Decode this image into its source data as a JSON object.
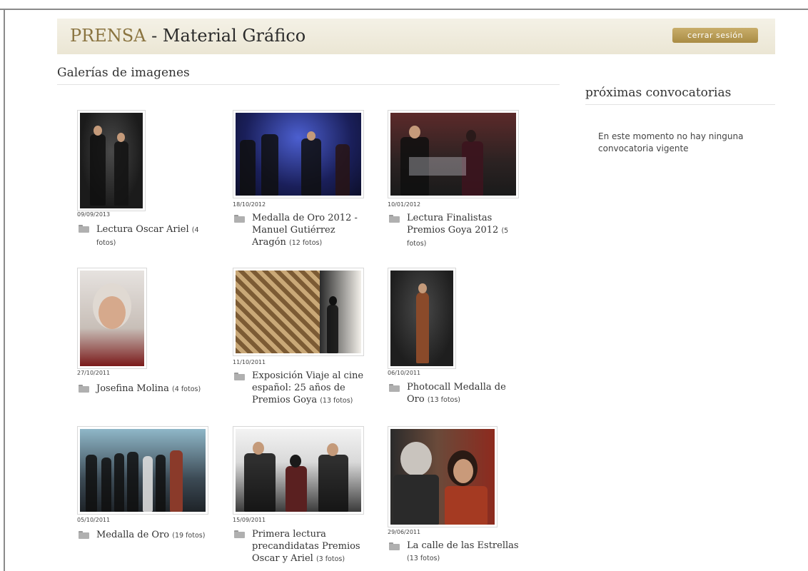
{
  "header": {
    "brand": "PRENSA",
    "title_rest": " - Material Gráfico",
    "logout_label": "cerrar sesión"
  },
  "main": {
    "section_title": "Galerías de imagenes",
    "galleries": [
      {
        "date": "09/09/2013",
        "title": "Lectura Oscar Ariel",
        "count": "(4 fotos)"
      },
      {
        "date": "18/10/2012",
        "title": "Medalla de Oro 2012 - Manuel Gutiérrez Aragón",
        "count": "(12 fotos)"
      },
      {
        "date": "10/01/2012",
        "title": "Lectura Finalistas Premios Goya 2012",
        "count": "(5 fotos)"
      },
      {
        "date": "27/10/2011",
        "title": "Josefina Molina",
        "count": "(4 fotos)"
      },
      {
        "date": "11/10/2011",
        "title": "Exposición Viaje al cine español: 25 años de Premios Goya",
        "count": "(13 fotos)"
      },
      {
        "date": "06/10/2011",
        "title": "Photocall Medalla de Oro",
        "count": "(13 fotos)"
      },
      {
        "date": "05/10/2011",
        "title": "Medalla de Oro",
        "count": "(19 fotos)"
      },
      {
        "date": "15/09/2011",
        "title": "Primera lectura precandidatas Premios Oscar y Ariel",
        "count": "(3 fotos)"
      },
      {
        "date": "29/06/2011",
        "title": "La calle de las Estrellas",
        "count": "(13 fotos)"
      }
    ]
  },
  "sidebar": {
    "title": "próximas convocatorias",
    "message": "En este momento no hay ninguna convocatoria vigente"
  },
  "colors": {
    "brand": "#8a7440",
    "button": "#b09550",
    "header_bg": "#efebdc"
  },
  "icons": {
    "gallery": "folder-icon"
  }
}
